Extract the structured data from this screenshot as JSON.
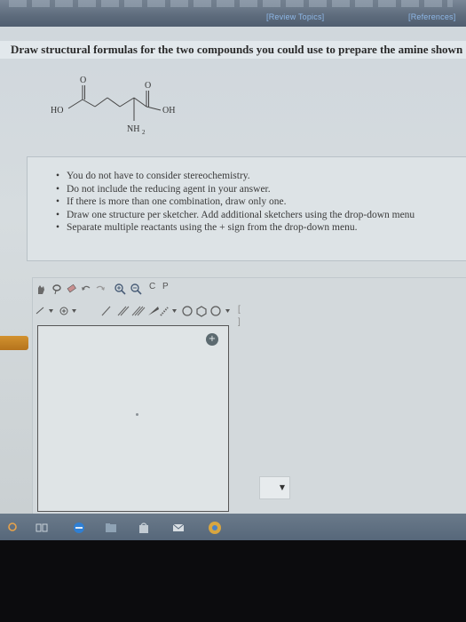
{
  "header": {
    "review_topics_link": "[Review Topics]",
    "references_link": "[References]"
  },
  "question": {
    "text": "Draw structural formulas for the two compounds you could use to prepare the amine shown"
  },
  "molecule": {
    "label_left": "HO",
    "label_right": "OH",
    "label_amine": "NH",
    "label_amine_subscript": "2",
    "label_carbonyl_left": "O",
    "label_carbonyl_right": "O"
  },
  "instructions": [
    "You do not have to consider stereochemistry.",
    "Do not include the reducing agent in your answer.",
    "If there is more than one combination, draw only one.",
    "Draw one structure per sketcher. Add additional sketchers using the drop-down menu",
    "Separate multiple reactants using the + sign from the drop-down menu."
  ],
  "sketcher": {
    "toolbar_text_c": "C",
    "toolbar_text_p": "P",
    "bracket_tool": "[ ]",
    "add_icon_glyph": "+"
  },
  "colors": {
    "link": "#8eb8e8",
    "accent_orange": "#c9862a"
  }
}
